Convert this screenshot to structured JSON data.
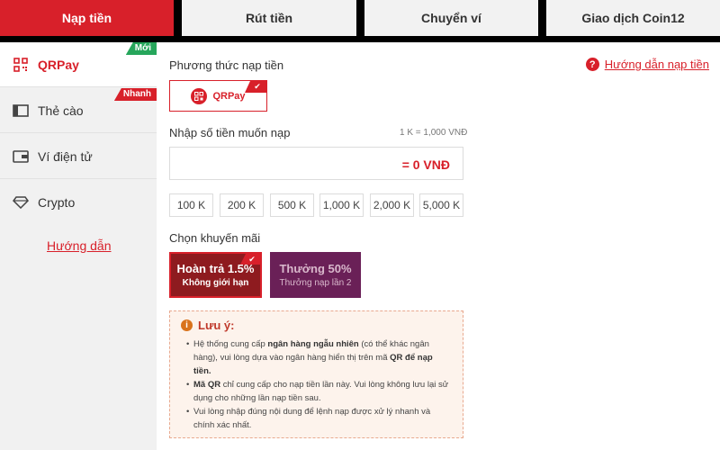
{
  "tabs": [
    {
      "label": "Nạp tiền",
      "active": true
    },
    {
      "label": "Rút tiền"
    },
    {
      "label": "Chuyển ví"
    },
    {
      "label": "Giao dịch Coin12"
    }
  ],
  "sidebar": {
    "items": [
      {
        "label": "QRPay",
        "icon": "qr-icon",
        "active": true,
        "badge": "Mới"
      },
      {
        "label": "Thẻ cào",
        "icon": "card-icon",
        "badge": "Nhanh"
      },
      {
        "label": "Ví điện tử",
        "icon": "wallet-icon"
      },
      {
        "label": "Crypto",
        "icon": "diamond-icon"
      }
    ],
    "guide_link": "Hướng dẫn"
  },
  "main": {
    "method_label": "Phương thức nạp tiền",
    "help_link": "Hướng dẫn nạp tiền",
    "help_icon": "?",
    "method_option": "QRPay",
    "check_mark": "✔",
    "amount_label": "Nhập số tiền muốn nạp",
    "rate": "1 K = 1,000 VNĐ",
    "amount_display": "= 0 VNĐ",
    "presets": [
      "100 K",
      "200 K",
      "500 K",
      "1,000 K",
      "2,000 K",
      "5,000 K"
    ],
    "promo_label": "Chọn khuyến mãi",
    "promos": [
      {
        "title": "Hoàn trả 1.5%",
        "subtitle": "Không giới hạn",
        "selected": true
      },
      {
        "title": "Thưởng 50%",
        "subtitle": "Thưởng nạp lần 2"
      }
    ],
    "note": {
      "icon": "i",
      "title": "Lưu ý:",
      "items": [
        {
          "t1": "Hệ thống cung cấp ",
          "b1": "ngân hàng ngẫu nhiên",
          "t2": " (có thể khác ngân hàng), vui lòng dựa vào ngân hàng hiển thị trên mã ",
          "b2": "QR để nạp tiền."
        },
        {
          "b1": "Mã QR",
          "t1": " chỉ cung cấp cho nạp tiền lần này. Vui lòng không lưu lại sử dụng cho những lần nạp tiền sau."
        },
        {
          "t1": "Vui lòng nhập đúng nội dung để lệnh nạp được xử lý nhanh và chính xác nhất."
        }
      ]
    }
  },
  "colors": {
    "accent": "#d8202a",
    "promo_selected": "#8e1b1f",
    "promo_other": "#6a2057",
    "badge_new": "#26a65b"
  }
}
